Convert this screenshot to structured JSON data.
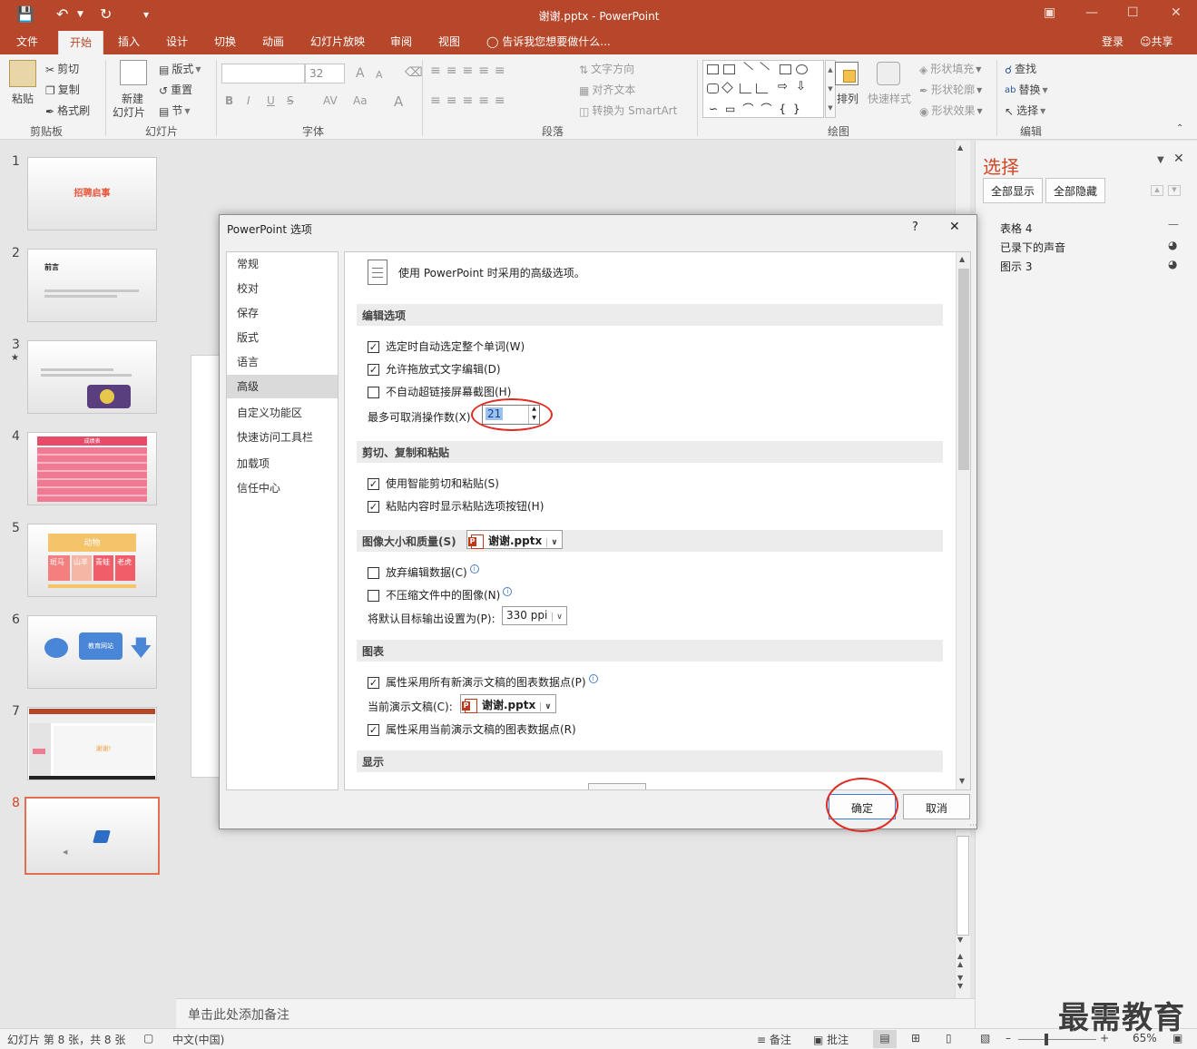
{
  "app": {
    "window_title": "谢谢.pptx - PowerPoint",
    "sign_in": "登录",
    "share": "共享",
    "tell_me": "告诉我您想要做什么...",
    "colors": {
      "accent": "#b7472a",
      "highlight_circle": "#e02b22"
    }
  },
  "tabs": [
    "文件",
    "开始",
    "插入",
    "设计",
    "切换",
    "动画",
    "幻灯片放映",
    "审阅",
    "视图"
  ],
  "ribbon": {
    "clipboard": {
      "label": "剪贴板",
      "paste": "粘贴",
      "cut": "剪切",
      "copy": "复制",
      "format_painter": "格式刷"
    },
    "slides": {
      "label": "幻灯片",
      "new_slide_1": "新建",
      "new_slide_2": "幻灯片",
      "layout": "版式",
      "reset": "重置",
      "section": "节"
    },
    "font": {
      "label": "字体",
      "size": "32",
      "bold": "B",
      "italic": "I",
      "underline": "U",
      "strike": "S",
      "spacing": "AV",
      "case": "Aa",
      "color": "A",
      "grow": "A",
      "shrink": "A"
    },
    "paragraph": {
      "label": "段落",
      "text_direction": "文字方向",
      "align_text": "对齐文本",
      "smartart": "转换为 SmartArt"
    },
    "drawing": {
      "label": "绘图",
      "arrange": "排列",
      "quick_styles": "快速样式",
      "shape_fill": "形状填充",
      "shape_outline": "形状轮廓",
      "shape_effects": "形状效果"
    },
    "editing": {
      "label": "编辑",
      "find": "查找",
      "replace": "替换",
      "select": "选择"
    }
  },
  "thumbnails": [
    {
      "num": "1",
      "title": "招聘启事"
    },
    {
      "num": "2",
      "title": "前言"
    },
    {
      "num": "3",
      "title": ""
    },
    {
      "num": "4",
      "title": "成绩表"
    },
    {
      "num": "5",
      "title": "动物",
      "cells": [
        "斑马",
        "山羊",
        "青蛙",
        "老虎"
      ]
    },
    {
      "num": "6",
      "title": "教育网站"
    },
    {
      "num": "7",
      "title": "谢谢!"
    },
    {
      "num": "8",
      "title": ""
    }
  ],
  "notes": {
    "placeholder": "单击此处添加备注"
  },
  "selection_pane": {
    "title": "选择",
    "show_all": "全部显示",
    "hide_all": "全部隐藏",
    "items": [
      "表格 4",
      "已录下的声音",
      "图示 3"
    ]
  },
  "dialog": {
    "title": "PowerPoint 选项",
    "help": "?",
    "close": "✕",
    "nav": [
      "常规",
      "校对",
      "保存",
      "版式",
      "语言",
      "高级",
      "自定义功能区",
      "快速访问工具栏",
      "加载项",
      "信任中心"
    ],
    "active_nav": "高级",
    "header": "使用 PowerPoint 时采用的高级选项。",
    "sections": {
      "editing": {
        "title": "编辑选项",
        "auto_select_word": "选定时自动选定整个单词(W)",
        "drag_drop": "允许拖放式文字编辑(D)",
        "no_hyperlink": "不自动超链接屏幕截图(H)",
        "max_undo_label": "最多可取消操作数(X)",
        "max_undo_value": "21"
      },
      "cut_copy_paste": {
        "title": "剪切、复制和粘贴",
        "smart_cut": "使用智能剪切和粘贴(S)",
        "show_paste_options": "粘贴内容时显示粘贴选项按钮(H)"
      },
      "image": {
        "title": "图像大小和质量(S)",
        "file": "谢谢.pptx",
        "discard_edit": "放弃编辑数据(C)",
        "no_compress": "不压缩文件中的图像(N)",
        "default_output_label": "将默认目标输出设置为(P):",
        "default_output_value": "330 ppi"
      },
      "chart": {
        "title": "图表",
        "props_all": "属性采用所有新演示文稿的图表数据点(P)",
        "current_doc_label": "当前演示文稿(C):",
        "current_doc_value": "谢谢.pptx",
        "props_current": "属性采用当前演示文稿的图表数据点(R)"
      },
      "display": {
        "title": "显示"
      }
    },
    "ok": "确定",
    "cancel": "取消"
  },
  "status": {
    "slide": "幻灯片 第 8 张，共 8 张",
    "language": "中文(中国)",
    "notes": "备注",
    "comments": "批注",
    "zoom": "65%"
  },
  "watermark": "最需教育"
}
